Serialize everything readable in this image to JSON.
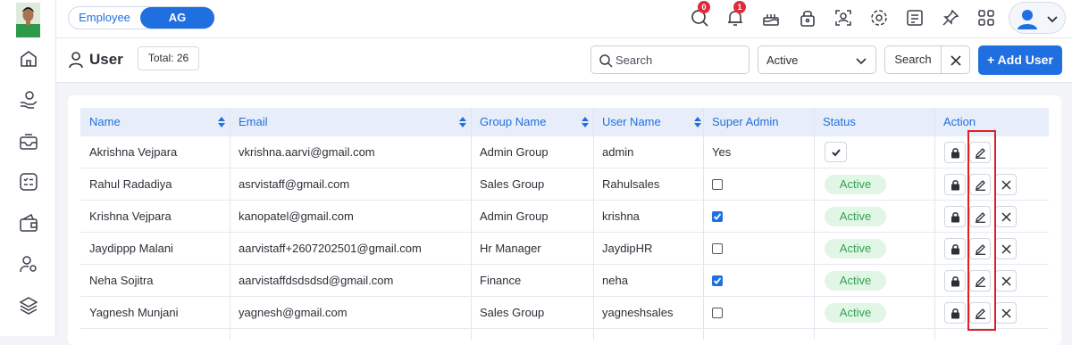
{
  "topbar": {
    "toggle_employee": "Employee",
    "toggle_ag": "AG",
    "search_badge": "0",
    "notification_badge": "1"
  },
  "page": {
    "title": "User",
    "total": "Total: 26"
  },
  "filters": {
    "search_placeholder": "Search",
    "status_value": "Active",
    "search_button": "Search",
    "add_button": "+ Add User"
  },
  "table": {
    "headers": {
      "name": "Name",
      "email": "Email",
      "group": "Group Name",
      "username": "User Name",
      "super_admin": "Super Admin",
      "status": "Status",
      "action": "Action"
    },
    "rows": [
      {
        "name": "Akrishna Vejpara",
        "email": "vkrishna.aarvi@gmail.com",
        "group": "Admin Group",
        "username": "admin",
        "super_admin": "Yes",
        "status": ""
      },
      {
        "name": "Rahul Radadiya",
        "email": "asrvistaff@gmail.com",
        "group": "Sales Group",
        "username": "Rahulsales",
        "super_admin": "",
        "status": "Active"
      },
      {
        "name": "Krishna Vejpara",
        "email": "kanopatel@gmail.com",
        "group": "Admin Group",
        "username": "krishna",
        "super_admin": "",
        "status": "Active"
      },
      {
        "name": "Jaydippp Malani",
        "email": "aarvistaff+2607202501@gmail.com",
        "group": "Hr Manager",
        "username": "JaydipHR",
        "super_admin": "",
        "status": "Active"
      },
      {
        "name": "Neha Sojitra",
        "email": "aarvistaffdsdsdsd@gmail.com",
        "group": "Finance",
        "username": "neha",
        "super_admin": "",
        "status": "Active"
      },
      {
        "name": "Yagnesh Munjani",
        "email": "yagnesh@gmail.com",
        "group": "Sales Group",
        "username": "yagneshsales",
        "super_admin": "",
        "status": "Active"
      }
    ]
  },
  "colors": {
    "accent": "#1f6fe0",
    "active_bg": "#e2f6e6",
    "active_text": "#2fa44f",
    "highlight": "#e01f25"
  },
  "icons": [
    "home-icon",
    "money-hand-icon",
    "inbox-icon",
    "checklist-icon",
    "wallet-icon",
    "user-settings-icon",
    "layers-icon",
    "search-icon",
    "bell-icon",
    "cake-icon",
    "lock-icon",
    "face-scan-icon",
    "gear-icon",
    "notes-icon",
    "pin-icon",
    "grid-icon",
    "user-icon",
    "edit-icon",
    "close-icon",
    "check-icon"
  ]
}
